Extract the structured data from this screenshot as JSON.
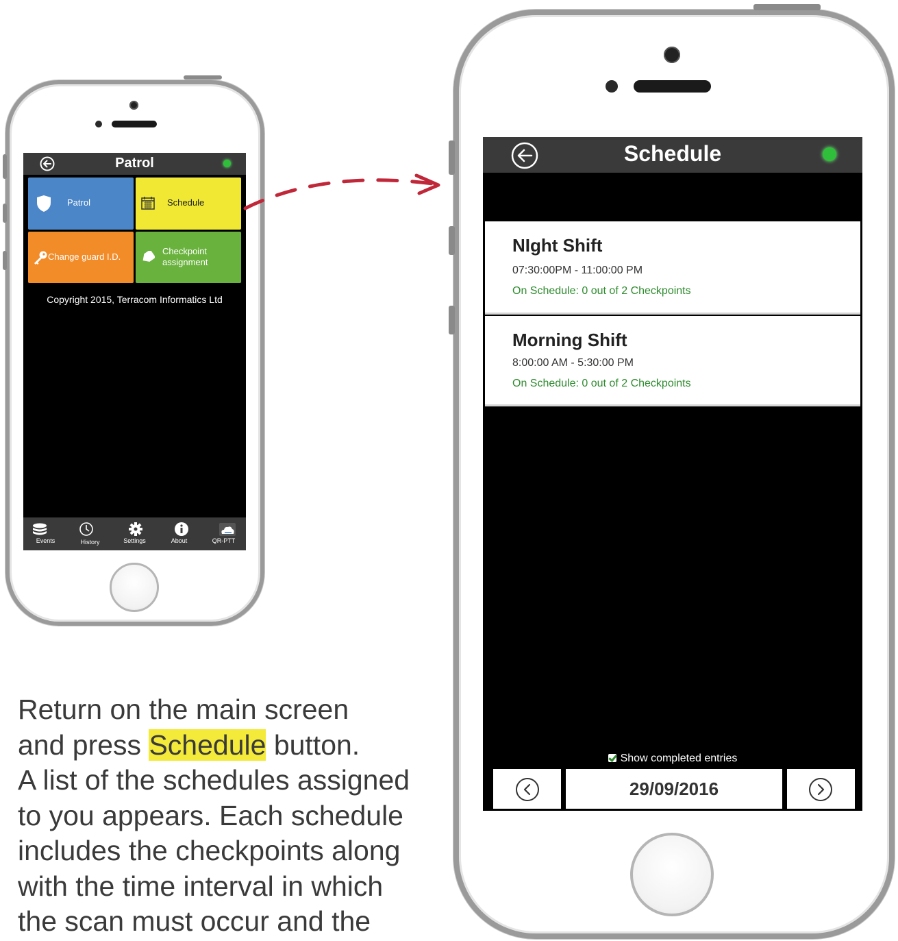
{
  "small_phone": {
    "header": {
      "title": "Patrol"
    },
    "tiles": [
      {
        "label": "Patrol",
        "color": "#4a86c8",
        "icon": "shield-icon"
      },
      {
        "label": "Schedule",
        "color": "#f0e833",
        "icon": "calendar-icon"
      },
      {
        "label": "Change guard I.D.",
        "color": "#f28c28",
        "icon": "key-icon"
      },
      {
        "label": "Checkpoint assignment",
        "color": "#6ab23e",
        "icon": "tag-icon"
      }
    ],
    "copyright": "Copyright 2015, Terracom Informatics Ltd",
    "tabs": [
      {
        "label": "Events",
        "icon": "database-icon"
      },
      {
        "label": "History",
        "icon": "clock-icon"
      },
      {
        "label": "Settings",
        "icon": "gear-icon"
      },
      {
        "label": "About",
        "icon": "info-icon"
      },
      {
        "label": "QR-PTT",
        "icon": "cloud-icon"
      }
    ]
  },
  "large_phone": {
    "header": {
      "title": "Schedule"
    },
    "schedules": [
      {
        "name": "NIght Shift",
        "time": "07:30:00PM - 11:00:00 PM",
        "status": "On Schedule: 0 out of 2 Checkpoints"
      },
      {
        "name": "Morning Shift",
        "time": "8:00:00 AM - 5:30:00 PM",
        "status": "On Schedule: 0 out of 2 Checkpoints"
      }
    ],
    "show_completed_label": "Show completed entries",
    "show_completed_checked": true,
    "date": "29/09/2016"
  },
  "description": {
    "line1": "Return on the main screen",
    "line2_pre": "and press ",
    "line2_highlight": "Schedule",
    "line2_post": " button.",
    "line3": "A list of the schedules assigned",
    "line4": "to you appears. Each schedule",
    "line5": "includes the checkpoints along",
    "line6": "with the time interval in which",
    "line7": "the scan must occur and the"
  },
  "colors": {
    "accent_arrow": "#c0283a",
    "status_green": "#2e8b2e",
    "highlight": "#f3ea3a"
  }
}
